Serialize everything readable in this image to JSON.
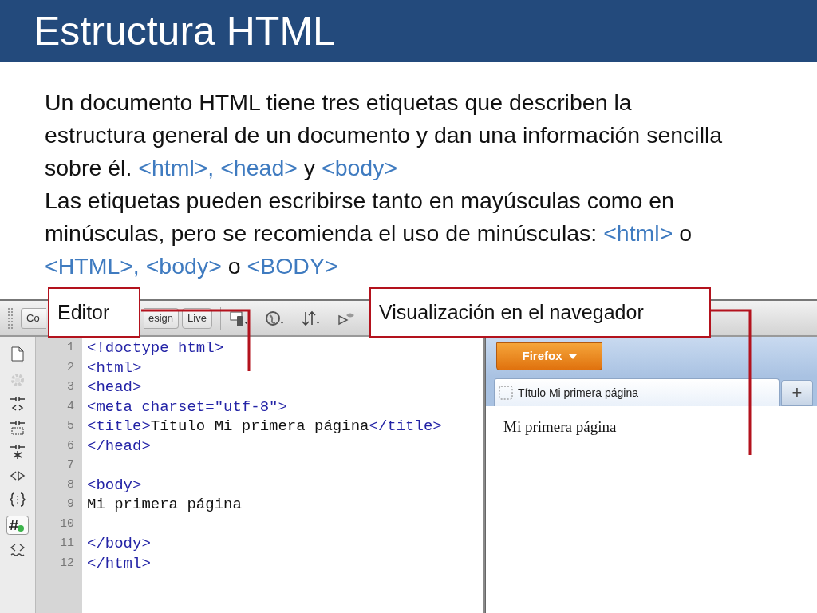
{
  "slide": {
    "title": "Estructura HTML",
    "paragraphs": [
      [
        {
          "kind": "plain",
          "text": "Un documento HTML tiene tres etiquetas que describen la\nestructura general de un documento y dan una información sencilla\nsobre él.  "
        },
        {
          "kind": "tag",
          "text": "<html>, <head>"
        },
        {
          "kind": "plain",
          "text": " y "
        },
        {
          "kind": "tag",
          "text": "<body>"
        }
      ],
      [
        {
          "kind": "plain",
          "text": "Las etiquetas pueden escribirse tanto en mayúsculas como en\nminúsculas, pero se recomienda el uso de minúsculas: "
        },
        {
          "kind": "tag",
          "text": "<html>"
        },
        {
          "kind": "plain",
          "text": " o\n"
        },
        {
          "kind": "tag",
          "text": "<HTML>, <body>"
        },
        {
          "kind": "plain",
          "text": " o "
        },
        {
          "kind": "tag",
          "text": "<BODY>"
        }
      ]
    ]
  },
  "callouts": [
    {
      "text": "Editor"
    },
    {
      "text": "Visualización en el navegador"
    }
  ],
  "editor": {
    "toolbar_buttons": [
      {
        "label": "Co"
      },
      {
        "label": "esign"
      },
      {
        "label": "Live"
      }
    ],
    "lines": [
      {
        "number": "1",
        "segments": [
          {
            "kind": "tag",
            "text": "<!doctype html>"
          }
        ]
      },
      {
        "number": "2",
        "segments": [
          {
            "kind": "tag",
            "text": "<html>"
          }
        ]
      },
      {
        "number": "3",
        "segments": [
          {
            "kind": "tag",
            "text": "<head>"
          }
        ]
      },
      {
        "number": "4",
        "segments": [
          {
            "kind": "tag",
            "text": "<meta charset=\"utf-8\">"
          }
        ]
      },
      {
        "number": "5",
        "segments": [
          {
            "kind": "tag",
            "text": "<title>"
          },
          {
            "kind": "text",
            "text": "Título Mi primera página"
          },
          {
            "kind": "tag",
            "text": "</title>"
          }
        ]
      },
      {
        "number": "6",
        "segments": [
          {
            "kind": "tag",
            "text": "</head>"
          }
        ]
      },
      {
        "number": "7"
      },
      {
        "number": "8",
        "segments": [
          {
            "kind": "tag",
            "text": "<body>"
          }
        ]
      },
      {
        "number": "9",
        "segments": [
          {
            "kind": "text",
            "text": "Mi primera página"
          }
        ]
      },
      {
        "number": "10"
      },
      {
        "number": "11",
        "segments": [
          {
            "kind": "tag",
            "text": "</body>"
          }
        ]
      },
      {
        "number": "12",
        "segments": [
          {
            "kind": "tag",
            "text": "</html>"
          }
        ]
      }
    ]
  },
  "browser": {
    "menu_button": "Firefox",
    "tab_title": "Título Mi primera página",
    "new_tab": "+",
    "content": "Mi primera página"
  }
}
